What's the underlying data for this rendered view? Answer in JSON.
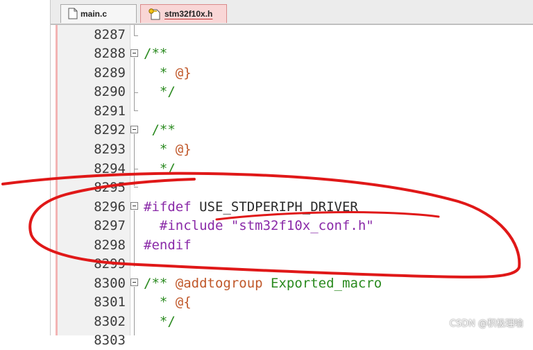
{
  "tabs": [
    {
      "label": "main.c"
    },
    {
      "label": "stm32f10x.h"
    }
  ],
  "line_numbers": [
    "8287",
    "8288",
    "8289",
    "8290",
    "8291",
    "8292",
    "8293",
    "8294",
    "8295",
    "8296",
    "8297",
    "8298",
    "8299",
    "8300",
    "8301",
    "8302",
    "8303"
  ],
  "code": {
    "l8288": "/**",
    "l8289_star": "* ",
    "l8289_tag": "@}",
    "l8290": "*/",
    "l8292": " /**",
    "l8293_star": "* ",
    "l8293_tag": "@}",
    "l8294": "*/",
    "l8296_kw": "#ifdef ",
    "l8296_id": "USE_STDPERIPH_DRIVER",
    "l8297_kw": "#include ",
    "l8297_str": "\"stm32f10x_conf.h\"",
    "l8298_kw": "#endif",
    "l8300_open": "/** ",
    "l8300_tag": "@addtogroup",
    "l8300_rest": " Exported_macro",
    "l8301_star": "* ",
    "l8301_tag": "@{",
    "l8302": "*/"
  },
  "watermark": "CSDN @积极理喻",
  "colors": {
    "comment": "#2a8a1f",
    "preprocessor": "#8a2aa8",
    "doctag": "#c0582a",
    "annotation": "#e01818",
    "active_tab": "#f9d6d6"
  },
  "icons": [
    "file-icon",
    "file-key-icon"
  ]
}
